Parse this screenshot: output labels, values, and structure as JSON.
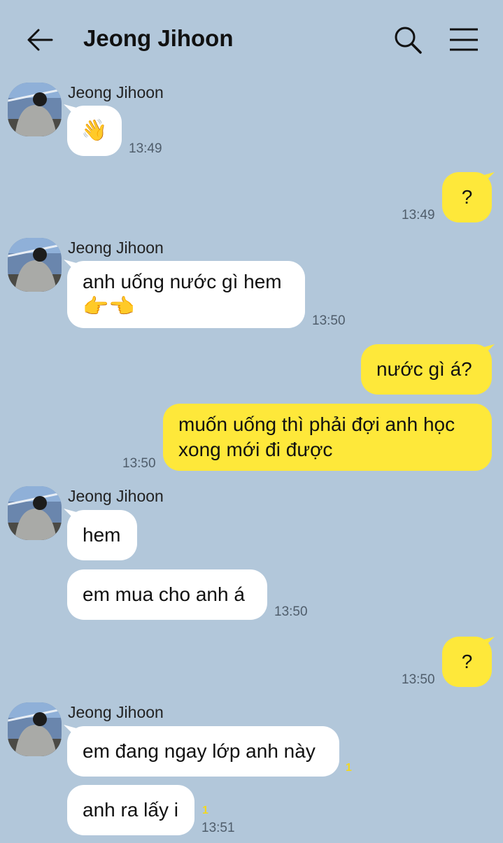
{
  "header": {
    "title": "Jeong Jihoon",
    "back_icon": "arrow-left-icon",
    "search_icon": "search-icon",
    "menu_icon": "hamburger-menu-icon"
  },
  "colors": {
    "background": "#b2c7da",
    "incoming_bubble": "#ffffff",
    "outgoing_bubble": "#fee83a",
    "unread_count": "#f2d81f"
  },
  "messages": [
    {
      "sender": "Jeong Jihoon",
      "text": "👋",
      "time": "13:49"
    },
    {
      "text": "?",
      "time": "13:49"
    },
    {
      "sender": "Jeong Jihoon",
      "line1": "anh uống nước gì hem",
      "line2": "👉👈",
      "time": "13:50"
    },
    {
      "text": "nước gì á?"
    },
    {
      "line1": "muốn uống thì phải đợi anh học",
      "line2": "xong mới đi được",
      "time": "13:50"
    },
    {
      "sender": "Jeong Jihoon",
      "text": "hem"
    },
    {
      "text": "em mua cho anh á",
      "time": "13:50"
    },
    {
      "text": "?",
      "time": "13:50"
    },
    {
      "sender": "Jeong Jihoon",
      "text": "em đang ngay lớp anh này",
      "unread": "1"
    },
    {
      "text": "anh ra lấy i",
      "unread": "1",
      "time": "13:51"
    }
  ]
}
